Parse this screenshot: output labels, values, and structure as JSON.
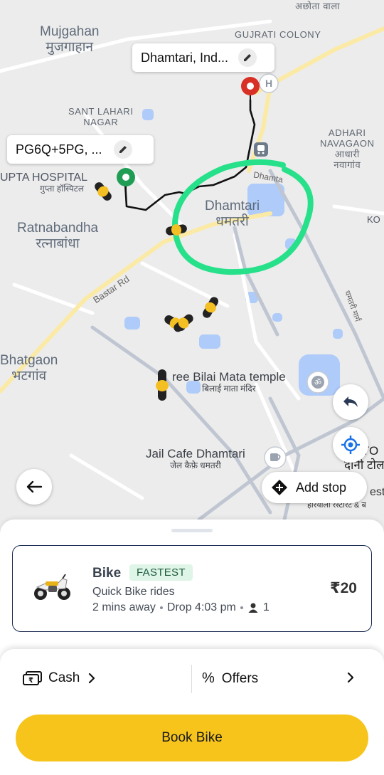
{
  "map": {
    "places": {
      "mujgahan_en": "Mujgahan",
      "mujgahan_hi": "मुजगाहान",
      "gujrati_colony": "GUJRATI COLONY",
      "sant_lahari_1": "SANT LAHARI",
      "sant_lahari_2": "NAGAR",
      "adhari_1": "ADHARI",
      "adhari_2": "NAVAGAON",
      "adhari_hi_1": "आधारी",
      "adhari_hi_2": "नवागांव",
      "gupta_hospital_en": "UPTA HOSPITAL",
      "gupta_hospital_hi": "गुप्ता हॉस्पिटल",
      "ratnabandha_en": "Ratnabandha",
      "ratnabandha_hi": "रत्नाबांधा",
      "dhamtari_en": "Dhamtari",
      "dhamtari_hi": "धमतरी",
      "bhatgaon_en": "Bhatgaon",
      "bhatgaon_hi": "भटगांव",
      "bilai_mata_en": "ree Bilai Mata temple",
      "bilai_mata_hi": "बिलाई माता मंदिर",
      "jail_cafe_en": "Jail Cafe Dhamtari",
      "jail_cafe_hi": "जेल कैफ़े धमतरी",
      "top_hi": "अछोता वाला",
      "right_ko": "KO",
      "right_dh": "D     TO",
      "right_dani": "दानी टोल",
      "right_est": "est",
      "right_haryala": "हारयाला रस्टारंट & ब",
      "bastar_rd": "Bastar Rd",
      "dhamtari_marg": "धमतरी मार्ग",
      "dhamta_road": "Dhamta"
    },
    "drop_label": "Dhamtari, Ind...",
    "pickup_label": "PG6Q+5PG, ...",
    "add_stop_label": "Add stop"
  },
  "ride": {
    "name": "Bike",
    "badge": "FASTEST",
    "description": "Quick Bike rides",
    "eta": "2 mins away",
    "drop_time": "Drop 4:03 pm",
    "seats": "1",
    "price": "₹20"
  },
  "payment": {
    "method": "Cash",
    "offers_label": "Offers"
  },
  "book_button": "Book Bike",
  "colors": {
    "accent_yellow": "#f6c41b",
    "route": "#111111",
    "highlight_circle": "#27e08a",
    "pickup_pin": "#1f9d55",
    "drop_pin": "#d93025"
  }
}
